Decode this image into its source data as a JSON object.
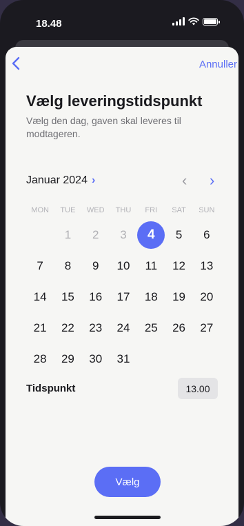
{
  "status_bar": {
    "time": "18.48"
  },
  "nav": {
    "back_icon": "chevron-left-icon",
    "cancel_label": "Annuller"
  },
  "header": {
    "title": "Vælg leveringstidspunkt",
    "subtitle": "Vælg den dag, gaven skal leveres til modtageren."
  },
  "calendar": {
    "month_label": "Januar 2024",
    "month_chevron": "›",
    "prev_month_icon": "‹",
    "next_month_icon": "›",
    "weekdays": [
      "MON",
      "TUE",
      "WED",
      "THU",
      "FRI",
      "SAT",
      "SUN"
    ],
    "leading_blanks": 1,
    "days": [
      {
        "label": "1",
        "state": "disabled"
      },
      {
        "label": "2",
        "state": "disabled"
      },
      {
        "label": "3",
        "state": "disabled"
      },
      {
        "label": "4",
        "state": "selected"
      },
      {
        "label": "5",
        "state": "available"
      },
      {
        "label": "6",
        "state": "available"
      },
      {
        "label": "7",
        "state": "available"
      },
      {
        "label": "8",
        "state": "available"
      },
      {
        "label": "9",
        "state": "available"
      },
      {
        "label": "10",
        "state": "available"
      },
      {
        "label": "11",
        "state": "available"
      },
      {
        "label": "12",
        "state": "available"
      },
      {
        "label": "13",
        "state": "available"
      },
      {
        "label": "14",
        "state": "available"
      },
      {
        "label": "15",
        "state": "available"
      },
      {
        "label": "16",
        "state": "available"
      },
      {
        "label": "17",
        "state": "available"
      },
      {
        "label": "18",
        "state": "available"
      },
      {
        "label": "19",
        "state": "available"
      },
      {
        "label": "20",
        "state": "available"
      },
      {
        "label": "21",
        "state": "available"
      },
      {
        "label": "22",
        "state": "available"
      },
      {
        "label": "23",
        "state": "available"
      },
      {
        "label": "24",
        "state": "available"
      },
      {
        "label": "25",
        "state": "available"
      },
      {
        "label": "26",
        "state": "available"
      },
      {
        "label": "27",
        "state": "available"
      },
      {
        "label": "28",
        "state": "available"
      },
      {
        "label": "29",
        "state": "available"
      },
      {
        "label": "30",
        "state": "available"
      },
      {
        "label": "31",
        "state": "available"
      }
    ]
  },
  "time": {
    "label": "Tidspunkt",
    "value": "13.00"
  },
  "actions": {
    "choose_label": "Vælg"
  },
  "colors": {
    "accent": "#5b6ef5",
    "background": "#f6f6f4",
    "disabled_text": "#b0b0b4"
  }
}
